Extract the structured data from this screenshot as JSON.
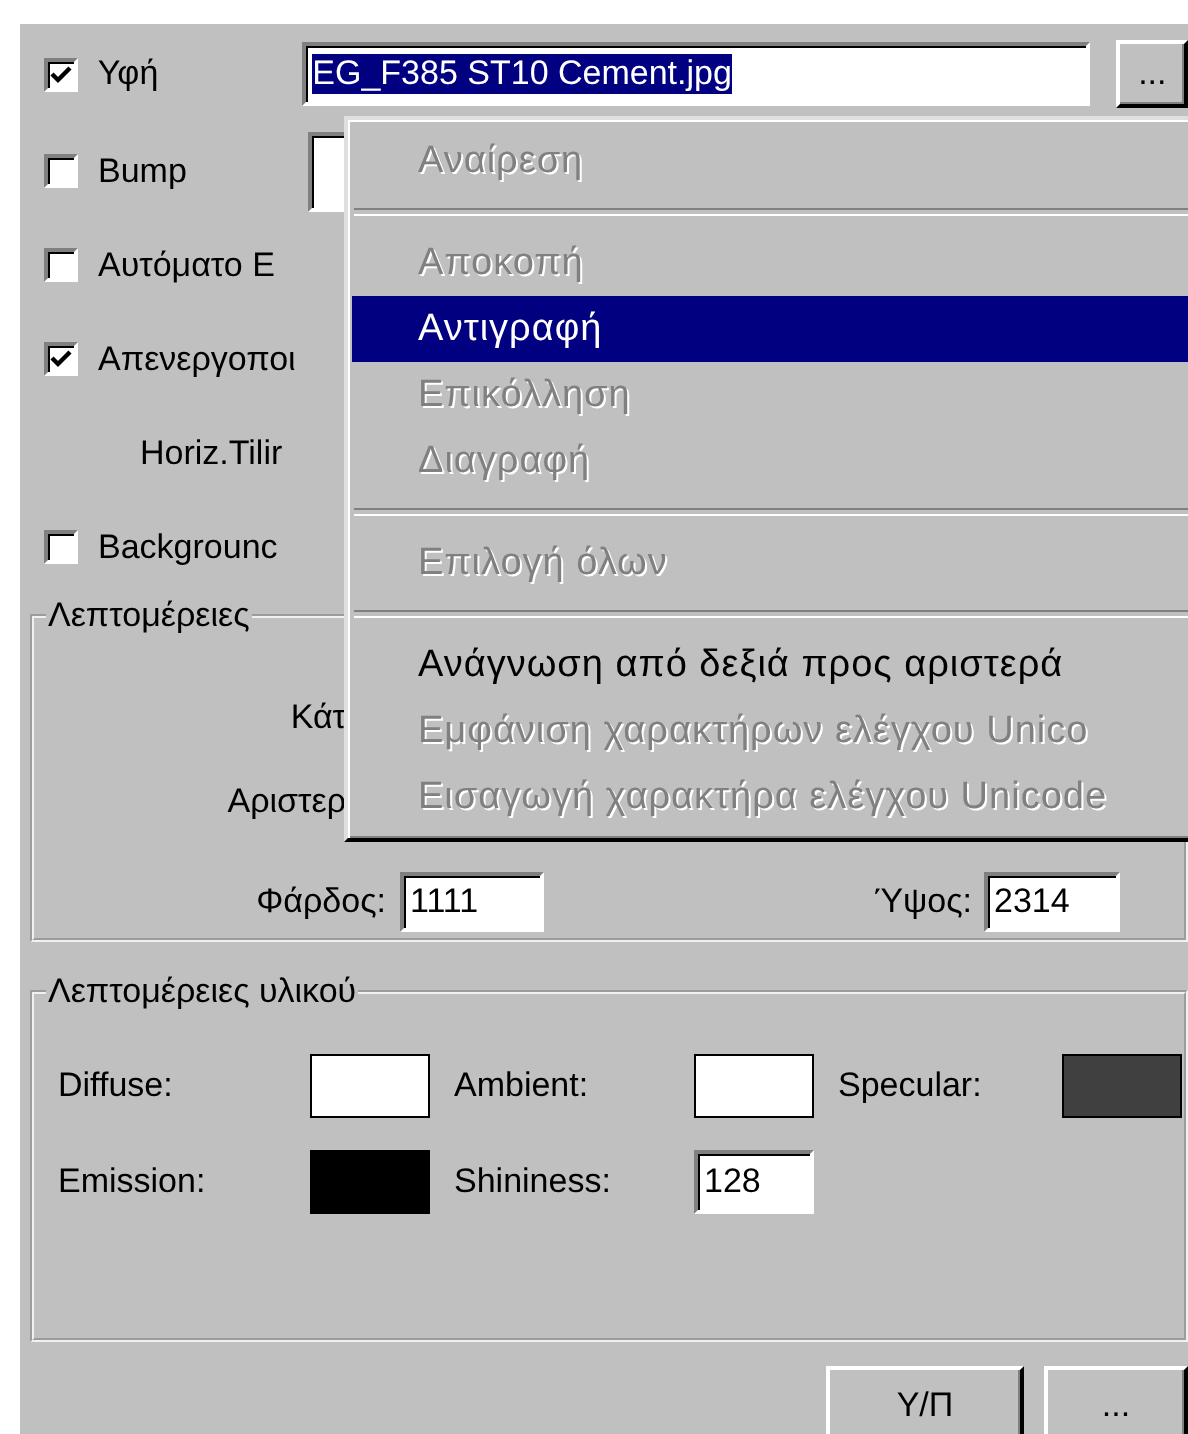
{
  "rows": [
    {
      "kind": "file",
      "label": "Υφή",
      "checked": true,
      "value": "EG_F385 ST10 Cement.jpg",
      "button": "..."
    },
    {
      "kind": "checkbox_field",
      "label": "Bump",
      "checked": false
    },
    {
      "kind": "checkbox",
      "label": "Αυτόματο Ε",
      "checked": false
    },
    {
      "kind": "checkbox",
      "label": "Απενεργοποι",
      "checked": true
    },
    {
      "kind": "label",
      "label": "Horiz.Tilir"
    },
    {
      "kind": "checkbox",
      "label": "Backgrounc",
      "checked": false
    }
  ],
  "details": {
    "title": "Λεπτομέρειες",
    "labels": [
      "Κάτ",
      "Αριστερ"
    ],
    "width": {
      "label": "Φάρδος:",
      "value": "1111"
    },
    "height": {
      "label": "Ύψος:",
      "value": "2314"
    }
  },
  "material": {
    "title": "Λεπτομέρειες υλικού",
    "swatches": [
      {
        "label": "Diffuse:",
        "color": "#ffffff"
      },
      {
        "label": "Ambient:",
        "color": "#ffffff"
      },
      {
        "label": "Specular:",
        "color": "#404040"
      },
      {
        "label": "Emission:",
        "color": "#000000"
      }
    ],
    "shininess": {
      "label": "Shininess:",
      "value": "128"
    }
  },
  "buttons": [
    "Υ/Π",
    "..."
  ],
  "menu": [
    {
      "kind": "item",
      "label": "Αναίρεση",
      "disabled": true,
      "selected": false
    },
    {
      "kind": "separator"
    },
    {
      "kind": "item",
      "label": "Αποκοπή",
      "disabled": true,
      "selected": false
    },
    {
      "kind": "item",
      "label": "Αντιγραφή",
      "disabled": false,
      "selected": true
    },
    {
      "kind": "item",
      "label": "Επικόλληση",
      "disabled": true,
      "selected": false
    },
    {
      "kind": "item",
      "label": "Διαγραφή",
      "disabled": true,
      "selected": false
    },
    {
      "kind": "separator"
    },
    {
      "kind": "item",
      "label": "Επιλογή όλων",
      "disabled": true,
      "selected": false
    },
    {
      "kind": "separator"
    },
    {
      "kind": "item",
      "label": "Ανάγνωση από δεξιά προς αριστερά",
      "disabled": false,
      "selected": false
    },
    {
      "kind": "item",
      "label": "Εμφάνιση χαρακτήρων ελέγχου Unico",
      "disabled": true,
      "selected": false
    },
    {
      "kind": "item",
      "label": "Εισαγωγή χαρακτήρα ελέγχου Unicode",
      "disabled": true,
      "selected": false
    }
  ]
}
